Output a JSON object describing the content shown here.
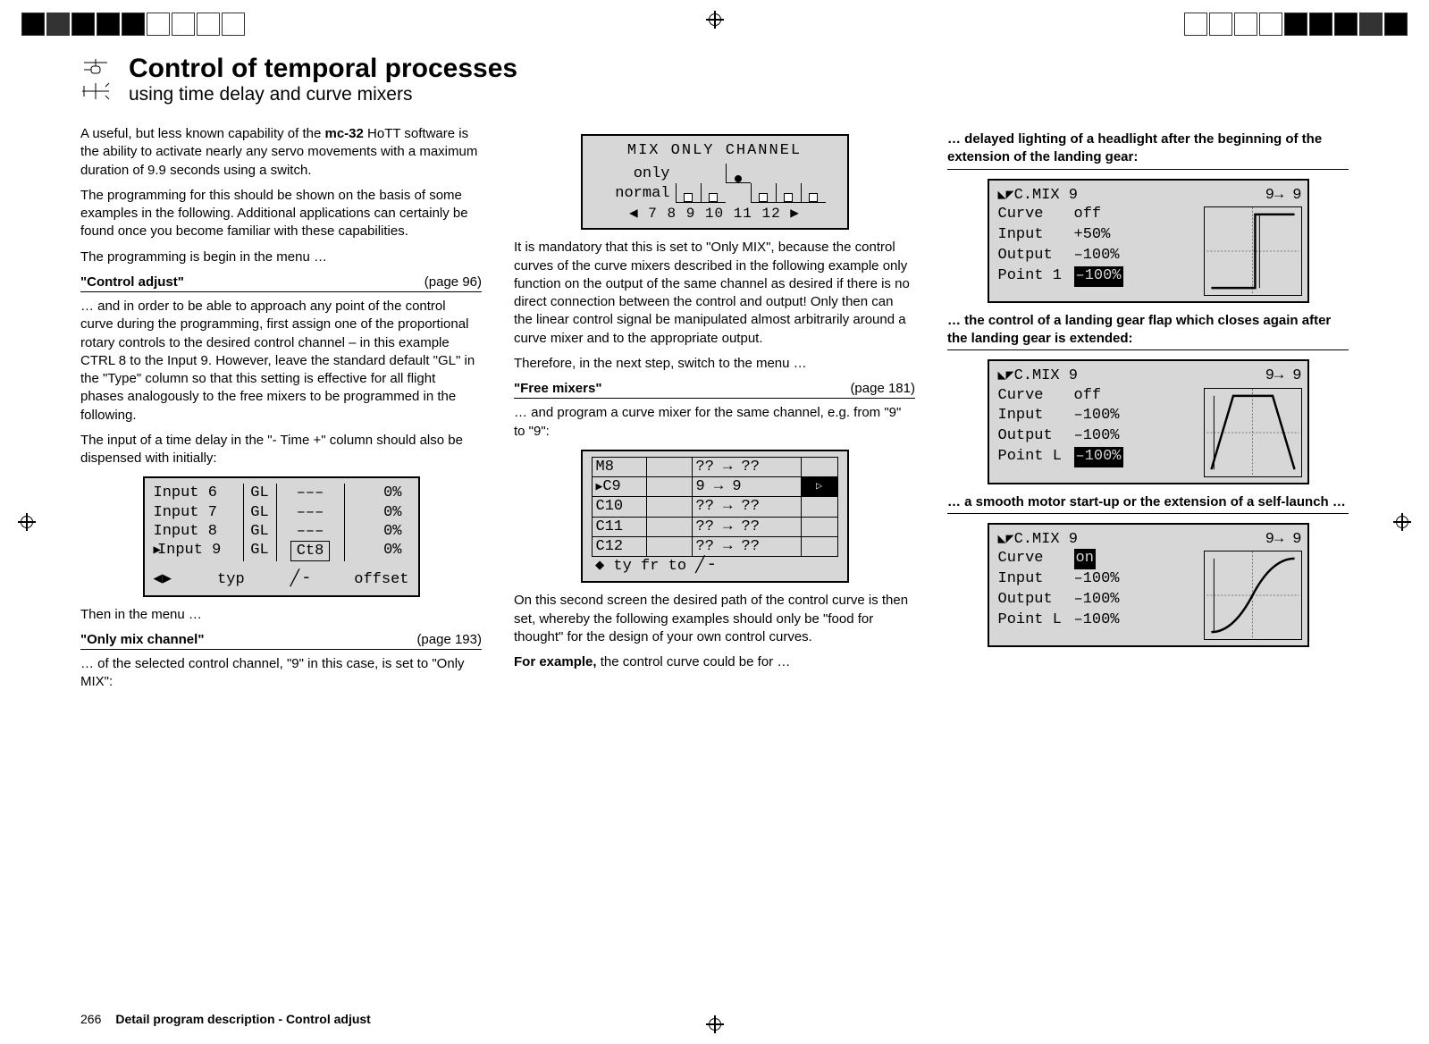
{
  "header": {
    "title": "Control of temporal processes",
    "subtitle": "using time delay and curve mixers"
  },
  "col1": {
    "p1_a": "A useful, but less known capability of the ",
    "p1_b": "mc-32",
    "p1_c": " HoTT software is the ability to activate nearly any servo movements with a maximum duration of 9.9 seconds using a switch.",
    "p2": "The programming for this should be shown on the basis of some examples in the following. Additional applications can certainly be found once you become familiar with these capabilities.",
    "p3": "The programming is begin in the menu …",
    "shead1_l": "\"Control adjust\"",
    "shead1_r": "(page 96)",
    "p4": "… and in order to be able to approach any point of the control curve during the programming, first assign one of the proportional rotary controls to the desired control channel  – in this example CTRL 8 to the Input 9. However, leave the standard default \"GL\" in the \"Type\" column so that this setting is effective for all flight phases analogously to the free mixers to be programmed in the following.",
    "p5": "The input of a time delay in the \"- Time +\" column should also be dispensed with initially:",
    "screen1": {
      "rows": [
        {
          "c1": "Input  6",
          "c2": "GL",
          "c3": "–––",
          "c4": "0%"
        },
        {
          "c1": "Input  7",
          "c2": "GL",
          "c3": "–––",
          "c4": "0%"
        },
        {
          "c1": "Input  8",
          "c2": "GL",
          "c3": "–––",
          "c4": "0%"
        },
        {
          "c1": "Input  9",
          "c2": "GL",
          "c3": "Ct8",
          "c4": "0%",
          "hl": true
        }
      ],
      "foot_l": "◀▶",
      "foot_m": "typ",
      "foot_sw": "╱╶",
      "foot_r": "offset"
    },
    "p6": "Then in the menu …",
    "shead2_l": "\"Only mix channel\"",
    "shead2_r": "(page 193)",
    "p7": "… of the selected control channel, \"9\" in this case, is set to \"Only MIX\":"
  },
  "col2": {
    "screen2": {
      "title": "MIX  ONLY  CHANNEL",
      "r1_label": "only",
      "r2_label": "normal",
      "nums": "◀ 7   8   9  10 11 12 ▶"
    },
    "p1": "It is mandatory that this is set to \"Only MIX\", because the control curves of the curve mixers described in the following example only function on the output of the same channel as desired if there is no direct connection between the control and output! Only then can the linear control signal be manipulated almost arbitrarily around a curve mixer and to the appropriate output.",
    "p2": "Therefore, in the next step, switch to the menu …",
    "shead1_l": "\"Free mixers\"",
    "shead1_r": "(page 181)",
    "p3": "… and program a curve mixer for the same channel, e.g. from \"9\" to \"9\":",
    "screen3": {
      "rows": [
        {
          "name": "M8",
          "mid": "?? → ??"
        },
        {
          "name": "C9",
          "mid": "9 →   9",
          "sel": true,
          "arrow": "▷"
        },
        {
          "name": "C10",
          "mid": "?? → ??"
        },
        {
          "name": "C11",
          "mid": "?? → ??"
        },
        {
          "name": "C12",
          "mid": "?? → ??"
        }
      ],
      "foot": "◆         ty     fr      to    ╱╶"
    },
    "p4": "On this second screen the desired path of the control curve is then set, whereby the following examples should only be \"food for thought\" for the design of your own control curves.",
    "p5_a": "For example,",
    "p5_b": " the control curve could be for …"
  },
  "col3": {
    "sub1": "… delayed lighting of a headlight after the beginning of the extension of the landing gear:",
    "scr_a": {
      "pre_l": "▲C.MIX  9",
      "pre_r": "9→  9",
      "lines": [
        {
          "k": "Curve",
          "v": "off"
        },
        {
          "k": "Input",
          "v": "+50%"
        },
        {
          "k": "Output",
          "v": "–100%"
        },
        {
          "k": "Point 1",
          "v": "–100%",
          "inv": true
        }
      ]
    },
    "sub2": "… the control of a landing gear flap which closes again after the landing gear is extended:",
    "scr_b": {
      "pre_l": "▲C.MIX  9",
      "pre_r": "9→  9",
      "lines": [
        {
          "k": "Curve",
          "v": "off"
        },
        {
          "k": "Input",
          "v": "–100%"
        },
        {
          "k": "Output",
          "v": "–100%"
        },
        {
          "k": "Point L",
          "v": "–100%",
          "inv": true
        }
      ]
    },
    "sub3": "… a smooth motor start-up or the extension of a self-launch …",
    "scr_c": {
      "pre_l": "▲C.MIX  9",
      "pre_r": "9→  9",
      "lines": [
        {
          "k": "Curve",
          "v": "on",
          "inv": true
        },
        {
          "k": "Input",
          "v": "–100%"
        },
        {
          "k": "Output",
          "v": "–100%"
        },
        {
          "k": "Point L",
          "v": "–100%"
        }
      ]
    }
  },
  "footer": {
    "page": "266",
    "text": "Detail program description - Control adjust"
  }
}
